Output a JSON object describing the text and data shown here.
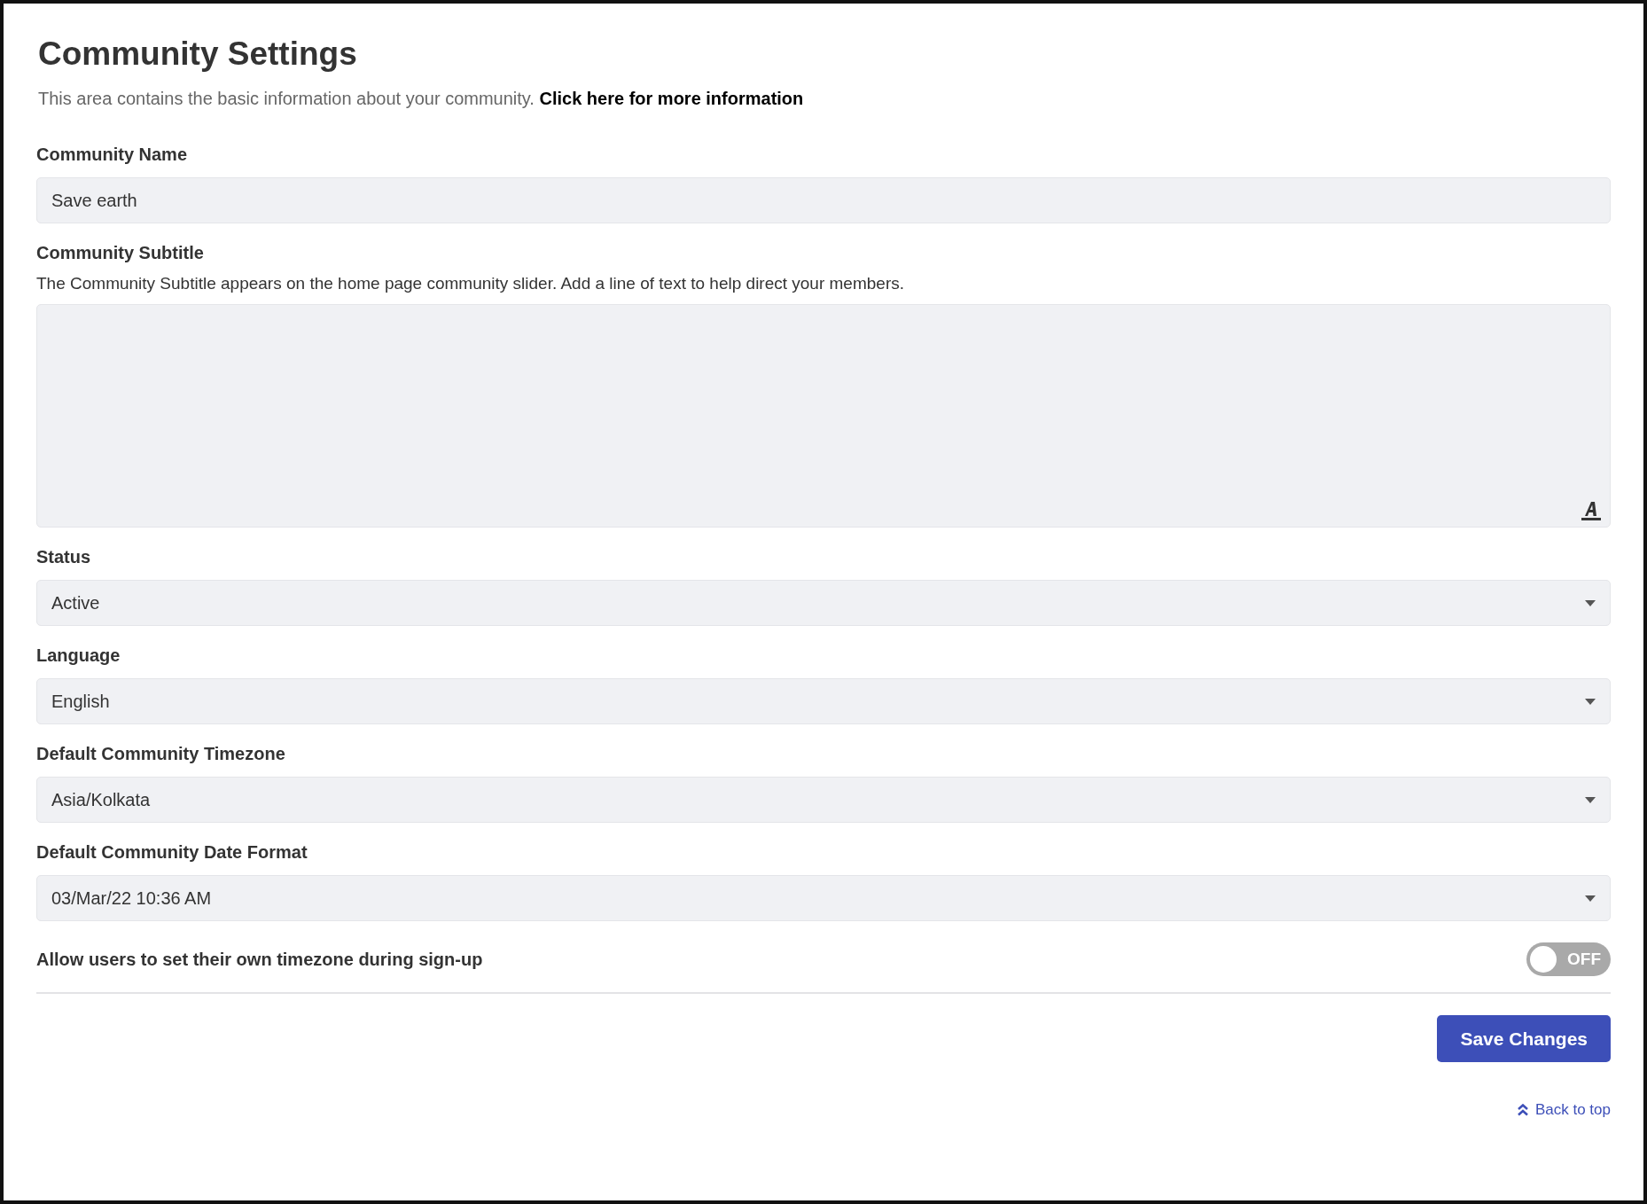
{
  "title": "Community Settings",
  "description": {
    "text": "This area contains the basic information about your community.",
    "link": "Click here for more information"
  },
  "fields": [
    {
      "kind": "text",
      "label": "Community Name",
      "value": "Save earth"
    },
    {
      "kind": "textarea",
      "label": "Community Subtitle",
      "help": "The Community Subtitle appears on the home page community slider. Add a line of text to help direct your members."
    },
    {
      "kind": "select",
      "label": "Status",
      "value": "Active"
    },
    {
      "kind": "select",
      "label": "Language",
      "value": "English"
    },
    {
      "kind": "select",
      "label": "Default Community Timezone",
      "value": "Asia/Kolkata"
    },
    {
      "kind": "select",
      "label": "Default Community Date Format",
      "value": "03/Mar/22 10:36 AM"
    }
  ],
  "toggle": {
    "label": "Allow users to set their own timezone during sign-up",
    "on": false,
    "state_text": "OFF"
  },
  "save_button": "Save Changes",
  "back_to_top": "Back to top"
}
